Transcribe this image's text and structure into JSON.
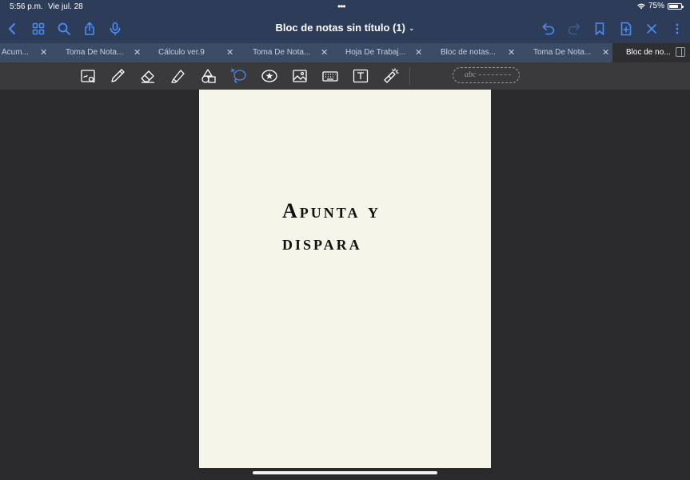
{
  "status": {
    "time": "5:56 p.m.",
    "date": "Vie jul. 28",
    "battery": "75%",
    "battery_level": 0.75
  },
  "nav": {
    "title": "Bloc de notas sin título (1)",
    "icons": [
      "back-icon",
      "grid-icon",
      "search-icon",
      "share-icon",
      "microphone-icon",
      "undo-icon",
      "redo-icon",
      "bookmark-icon",
      "add-page-icon",
      "close-icon"
    ]
  },
  "tabs": [
    {
      "label": "Acum..."
    },
    {
      "label": "Toma De Nota..."
    },
    {
      "label": "Cálculo ver.9"
    },
    {
      "label": "Toma De Nota..."
    },
    {
      "label": "Hoja De Trabaj..."
    },
    {
      "label": "Bloc de notas..."
    },
    {
      "label": "Toma De Nota..."
    },
    {
      "label": "Bloc de no...",
      "active": true
    }
  ],
  "toolbar": {
    "tools": [
      "zoom-window-icon",
      "pen-icon",
      "eraser-icon",
      "highlighter-icon",
      "shapes-icon",
      "lasso-icon",
      "sticker-icon",
      "image-icon",
      "keyboard-icon",
      "text-box-icon",
      "laser-pointer-icon"
    ],
    "handwriting_placeholder": "abc"
  },
  "page": {
    "text_line1": "Apunta y",
    "text_line2": "dispara"
  },
  "colors": {
    "nav_bg": "#2d3d59",
    "tab_bg": "#3c4b66",
    "accent": "#4a8df8",
    "page_bg": "#f6f5ea",
    "canvas_bg": "#2a2a2c"
  }
}
